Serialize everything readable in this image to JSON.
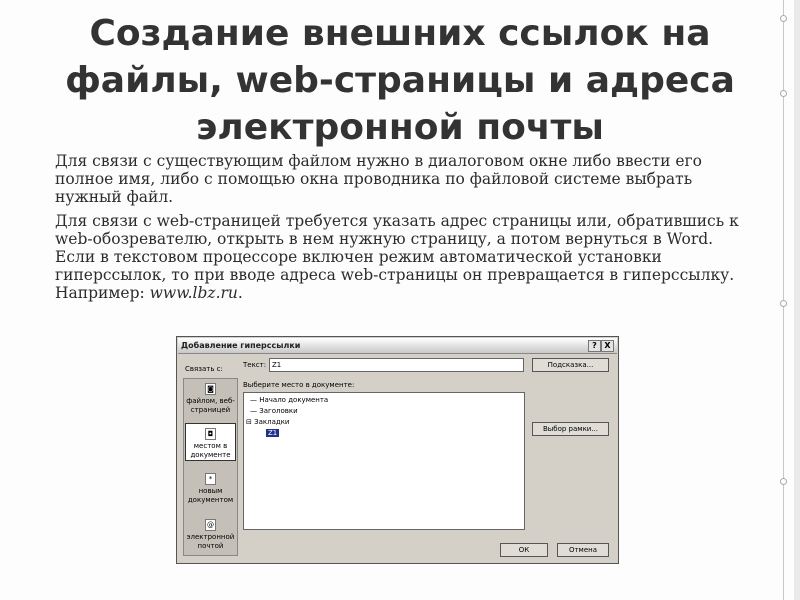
{
  "slide": {
    "title_line1": "Создание внешних ссылок на",
    "title_line2": "файлы, web-страницы и адреса",
    "title_line3": "электронной почты",
    "paragraph1": "Для связи с существующим файлом нужно в диалоговом окне либо ввести его полное имя, либо с помощью окна проводника по файловой системе выбрать нужный файл.",
    "paragraph2_text": "Для связи с web-страницей требуется указать адрес страницы или, обратившись к web-обозревателю, открыть в нем нужную страницу, а потом вернуться в Word. Если в текстовом процессоре включен режим автоматической установки гиперссылок, то при вводе адреса web-страницы он превращается в гиперссылку. Например: ",
    "paragraph2_example": "www.lbz.ru",
    "paragraph2_end": "."
  },
  "dialog": {
    "title": "Добавление гиперссылки",
    "help": "?",
    "close": "X",
    "link_with_label": "Связать с:",
    "sidebar": [
      {
        "line1": "файлом, веб-",
        "line2": "страницей",
        "icon": "file-icon"
      },
      {
        "line1": "местом в",
        "line2": "документе",
        "icon": "place-icon"
      },
      {
        "line1": "новым",
        "line2": "документом",
        "icon": "new-doc-icon"
      },
      {
        "line1": "электронной",
        "line2": "почтой",
        "icon": "mail-icon"
      }
    ],
    "text_label": "Текст:",
    "text_value": "Z1",
    "hint_button": "Подсказка...",
    "place_label": "Выберите место в документе:",
    "tree": {
      "item1": "Начало документа",
      "item2": "Заголовки",
      "item3": "Закладки",
      "item4": "Z1"
    },
    "frame_button": "Выбор рамки...",
    "ok_button": "ОК",
    "cancel_button": "Отмена"
  }
}
